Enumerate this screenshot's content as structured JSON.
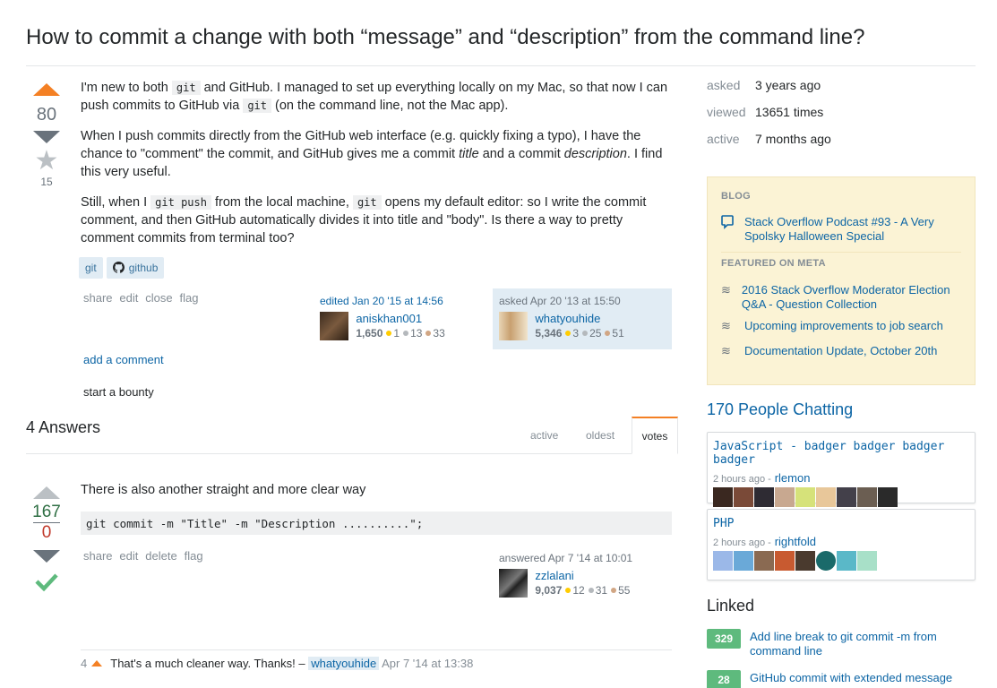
{
  "question": {
    "title": "How to commit a change with both “message” and “description” from the command line?",
    "votes": "80",
    "favorites": "15",
    "body": {
      "p1_a": "I'm new to both ",
      "p1_code1": "git",
      "p1_b": " and GitHub. I managed to set up everything locally on my Mac, so that now I can push commits to GitHub via ",
      "p1_code2": "git",
      "p1_c": " (on the command line, not the Mac app).",
      "p2_a": "When I push commits directly from the GitHub web interface (e.g. quickly fixing a typo), I have the chance to \"comment\" the commit, and GitHub gives me a commit ",
      "p2_em1": "title",
      "p2_b": " and a commit ",
      "p2_em2": "description",
      "p2_c": ". I find this very useful.",
      "p3_a": "Still, when I ",
      "p3_code1": "git push",
      "p3_b": " from the local machine, ",
      "p3_code2": "git",
      "p3_c": " opens my default editor: so I write the commit comment, and then GitHub automatically divides it into title and \"body\". Is there a way to pretty comment commits from terminal too?"
    },
    "tags": [
      "git",
      "github"
    ],
    "menu": [
      "share",
      "edit",
      "close",
      "flag"
    ],
    "edited": {
      "action": "edited Jan 20 '15 at 14:56",
      "user": "aniskhan001",
      "rep": "1,650",
      "gold": "1",
      "silver": "13",
      "bronze": "33"
    },
    "asked": {
      "action": "asked Apr 20 '13 at 15:50",
      "user": "whatyouhide",
      "rep": "5,346",
      "gold": "3",
      "silver": "25",
      "bronze": "51"
    },
    "add_comment": "add a comment",
    "bounty": "start a bounty"
  },
  "answers_header": {
    "count": "4 Answers",
    "tabs": [
      "active",
      "oldest",
      "votes"
    ]
  },
  "answer": {
    "score_up": "167",
    "score_down": "0",
    "text": "There is also another straight and more clear way",
    "code": "git commit -m \"Title\" -m \"Description ..........\";",
    "menu": [
      "share",
      "edit",
      "delete",
      "flag"
    ],
    "answered": {
      "action": "answered Apr 7 '14 at 10:01",
      "user": "zzlalani",
      "rep": "9,037",
      "gold": "12",
      "silver": "31",
      "bronze": "55"
    },
    "comment": {
      "score": "4",
      "text": "That's a much cleaner way. Thanks! –",
      "user": "whatyouhide",
      "date": "Apr 7 '14 at 13:38"
    }
  },
  "sidebar": {
    "stats": [
      {
        "label": "asked",
        "value": "3 years ago"
      },
      {
        "label": "viewed",
        "value": "13651 times"
      },
      {
        "label": "active",
        "value": "7 months ago"
      }
    ],
    "blog_head": "BLOG",
    "blog_items": [
      "Stack Overflow Podcast #93 - A Very Spolsky Halloween Special"
    ],
    "meta_head": "FEATURED ON META",
    "meta_items": [
      "2016 Stack Overflow Moderator Election Q&A - Question Collection",
      "Upcoming improvements to job search",
      "Documentation Update, October 20th"
    ],
    "chat_title": "170 People Chatting",
    "rooms": [
      {
        "name": "JavaScript - badger badger badger badger",
        "time": "2 hours ago -",
        "user": "rlemon"
      },
      {
        "name": "PHP",
        "time": "2 hours ago -",
        "user": "rightfold"
      }
    ],
    "linked_title": "Linked",
    "linked": [
      {
        "count": "329",
        "text": "Add line break to git commit -m from command line"
      },
      {
        "count": "28",
        "text": "GitHub commit with extended message"
      }
    ]
  },
  "colors": {
    "accent": "#f48024",
    "link": "#0c65a5",
    "accepted": "#5eba7d",
    "tag_bg": "#e1ecf4"
  }
}
